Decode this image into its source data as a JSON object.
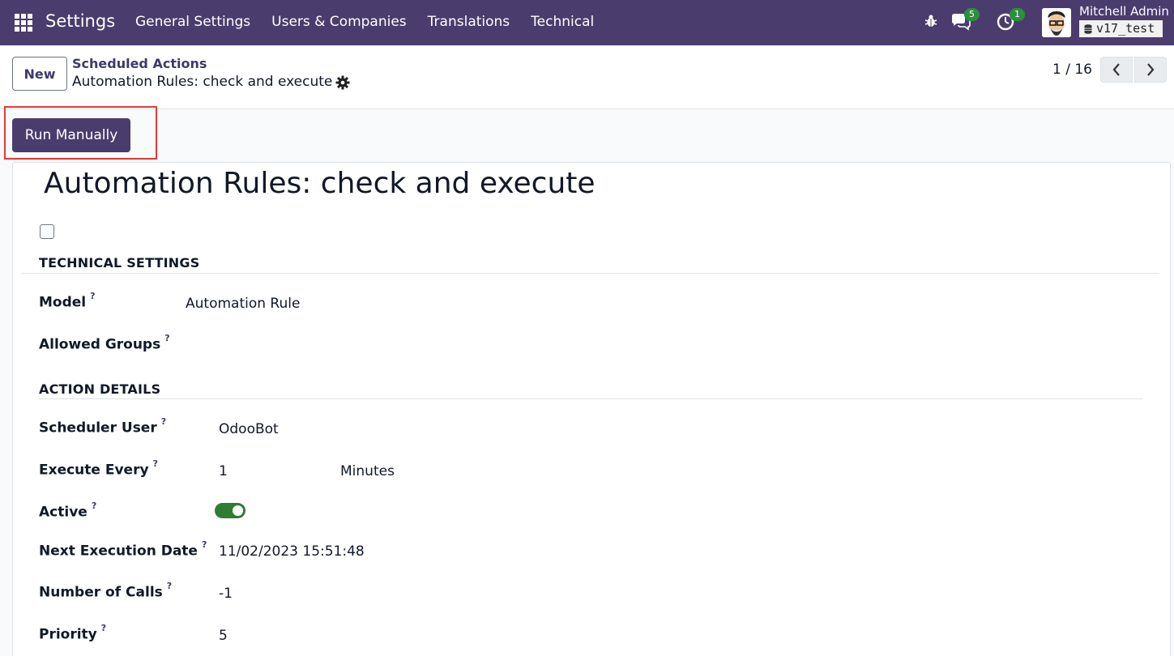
{
  "navbar": {
    "app_title": "Settings",
    "menu": [
      "General Settings",
      "Users & Companies",
      "Translations",
      "Technical"
    ],
    "chat_count": "5",
    "activity_count": "1",
    "user_name": "Mitchell Admin",
    "db_name": "v17_test",
    "bg_color": "#4b3c6e"
  },
  "control_panel": {
    "new_label": "New",
    "breadcrumb_parent": "Scheduled Actions",
    "breadcrumb_current": "Automation Rules: check and execute",
    "pager_value": "1 / 16"
  },
  "run_manually_label": "Run Manually",
  "form": {
    "title": "Automation Rules: check and execute",
    "technical_settings_title": "TECHNICAL SETTINGS",
    "model_label": "Model",
    "model_value": "Automation Rule",
    "allowed_groups_label": "Allowed Groups",
    "action_details_title": "ACTION DETAILS",
    "scheduler_user_label": "Scheduler User",
    "scheduler_user_value": "OdooBot",
    "execute_every_label": "Execute Every",
    "execute_every_value": "1",
    "execute_every_unit": "Minutes",
    "active_label": "Active",
    "active_value": true,
    "next_exec_label": "Next Execution Date",
    "next_exec_value": "11/02/2023 15:51:48",
    "num_calls_label": "Number of Calls",
    "num_calls_value": "-1",
    "priority_label": "Priority",
    "priority_value": "5",
    "help_mark": "?"
  }
}
